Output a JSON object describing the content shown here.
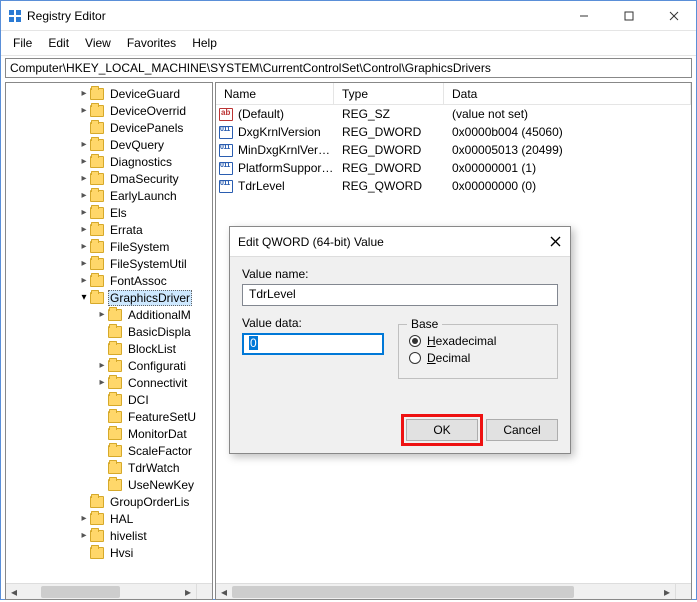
{
  "window": {
    "title": "Registry Editor"
  },
  "menubar": [
    "File",
    "Edit",
    "View",
    "Favorites",
    "Help"
  ],
  "address": "Computer\\HKEY_LOCAL_MACHINE\\SYSTEM\\CurrentControlSet\\Control\\GraphicsDrivers",
  "columns": {
    "name": "Name",
    "type": "Type",
    "data": "Data"
  },
  "tree": [
    {
      "level": 4,
      "arrow": ">",
      "label": "DeviceGuard"
    },
    {
      "level": 4,
      "arrow": ">",
      "label": "DeviceOverrid"
    },
    {
      "level": 4,
      "arrow": "",
      "label": "DevicePanels"
    },
    {
      "level": 4,
      "arrow": ">",
      "label": "DevQuery"
    },
    {
      "level": 4,
      "arrow": ">",
      "label": "Diagnostics"
    },
    {
      "level": 4,
      "arrow": ">",
      "label": "DmaSecurity"
    },
    {
      "level": 4,
      "arrow": ">",
      "label": "EarlyLaunch"
    },
    {
      "level": 4,
      "arrow": ">",
      "label": "Els"
    },
    {
      "level": 4,
      "arrow": ">",
      "label": "Errata"
    },
    {
      "level": 4,
      "arrow": ">",
      "label": "FileSystem"
    },
    {
      "level": 4,
      "arrow": ">",
      "label": "FileSystemUtil"
    },
    {
      "level": 4,
      "arrow": ">",
      "label": "FontAssoc"
    },
    {
      "level": 4,
      "arrow": "v",
      "label": "GraphicsDriver",
      "active": true
    },
    {
      "level": 5,
      "arrow": ">",
      "label": "AdditionalM"
    },
    {
      "level": 5,
      "arrow": "",
      "label": "BasicDispla"
    },
    {
      "level": 5,
      "arrow": "",
      "label": "BlockList"
    },
    {
      "level": 5,
      "arrow": ">",
      "label": "Configurati"
    },
    {
      "level": 5,
      "arrow": ">",
      "label": "Connectivit"
    },
    {
      "level": 5,
      "arrow": "",
      "label": "DCI"
    },
    {
      "level": 5,
      "arrow": "",
      "label": "FeatureSetU"
    },
    {
      "level": 5,
      "arrow": "",
      "label": "MonitorDat"
    },
    {
      "level": 5,
      "arrow": "",
      "label": "ScaleFactor"
    },
    {
      "level": 5,
      "arrow": "",
      "label": "TdrWatch"
    },
    {
      "level": 5,
      "arrow": "",
      "label": "UseNewKey"
    },
    {
      "level": 4,
      "arrow": "",
      "label": "GroupOrderLis"
    },
    {
      "level": 4,
      "arrow": ">",
      "label": "HAL"
    },
    {
      "level": 4,
      "arrow": ">",
      "label": "hivelist"
    },
    {
      "level": 4,
      "arrow": "",
      "label": "Hvsi"
    }
  ],
  "values": [
    {
      "icon": "str",
      "name": "(Default)",
      "type": "REG_SZ",
      "data": "(value not set)"
    },
    {
      "icon": "bin",
      "name": "DxgKrnlVersion",
      "type": "REG_DWORD",
      "data": "0x0000b004 (45060)"
    },
    {
      "icon": "bin",
      "name": "MinDxgKrnlVersi…",
      "type": "REG_DWORD",
      "data": "0x00005013 (20499)"
    },
    {
      "icon": "bin",
      "name": "PlatformSuppor…",
      "type": "REG_DWORD",
      "data": "0x00000001 (1)"
    },
    {
      "icon": "bin",
      "name": "TdrLevel",
      "type": "REG_QWORD",
      "data": "0x00000000 (0)"
    }
  ],
  "dialog": {
    "title": "Edit QWORD (64-bit) Value",
    "value_name_label": "Value name:",
    "value_name": "TdrLevel",
    "value_data_label": "Value data:",
    "value_data": "0",
    "base_label": "Base",
    "hex_label": "Hexadecimal",
    "dec_label": "Decimal",
    "base_selected": "hex",
    "ok": "OK",
    "cancel": "Cancel"
  }
}
